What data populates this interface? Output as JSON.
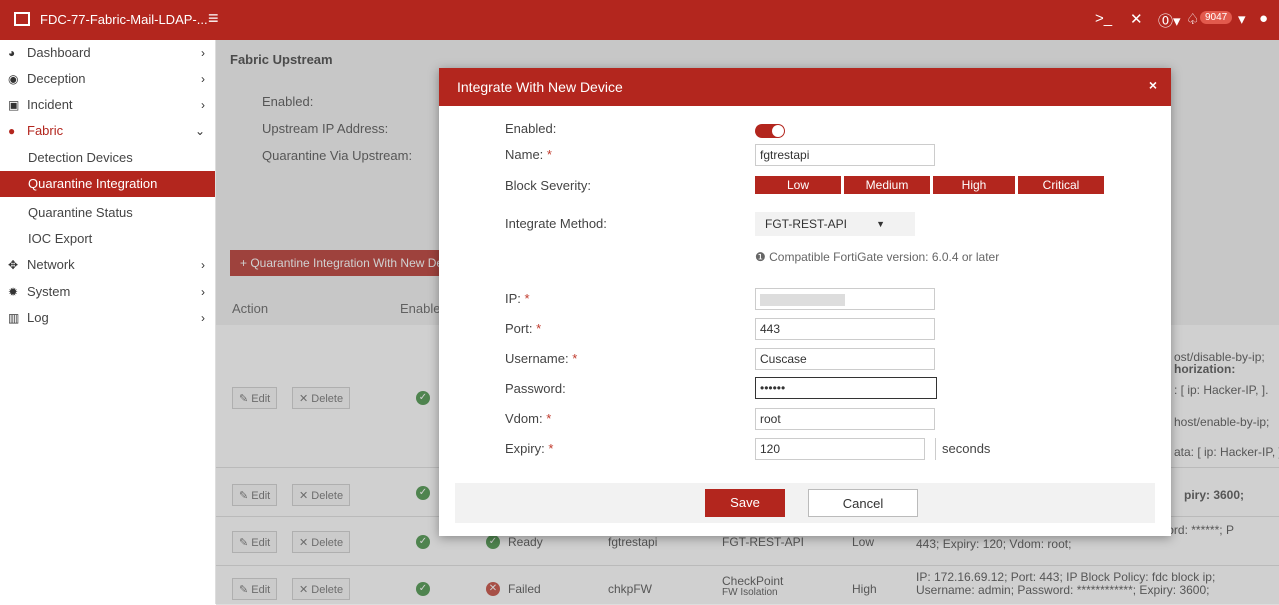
{
  "topbar": {
    "app_title": "FDC-77-Fabric-Mail-LDAP-...",
    "alert_count": "9047",
    "icons": [
      "terminal-icon",
      "tools-icon",
      "help-icon",
      "bell-icon",
      "user-icon"
    ]
  },
  "sidebar": {
    "items": [
      {
        "label": "Dashboard",
        "icon": "dashboard-icon"
      },
      {
        "label": "Deception",
        "icon": "deception-icon"
      },
      {
        "label": "Incident",
        "icon": "incident-icon"
      },
      {
        "label": "Fabric",
        "icon": "fabric-icon"
      },
      {
        "label": "Network",
        "icon": "network-icon"
      },
      {
        "label": "System",
        "icon": "gear-icon"
      },
      {
        "label": "Log",
        "icon": "log-icon"
      }
    ],
    "fabric_sub": [
      "Detection Devices",
      "Quarantine Integration",
      "Quarantine Status",
      "IOC Export"
    ]
  },
  "main": {
    "section_title": "Fabric Upstream",
    "upstream_labels": [
      "Enabled:",
      "Upstream IP Address:",
      "Quarantine Via Upstream:"
    ],
    "add_button": "+ Quarantine Integration With New Device",
    "columns": {
      "action": "Action",
      "enabled": "Enabled"
    },
    "edit_label": "Edit",
    "delete_label": "Delete",
    "row1_details": [
      "ost/disable-by-ip;",
      "horization:",
      ": [ ip: Hacker-IP, ].",
      "host/enable-by-ip;",
      "ata: [ ip: Hacker-IP, ]"
    ],
    "row2_details": "piry: 3600;",
    "row3": {
      "status": "Ready",
      "name": "fgtrestapi",
      "method": "FGT-REST-API",
      "severity": "Low",
      "detail_line1": "IP: 172.16.69.113;  Username: Cuscase;  Password: ******;  P",
      "detail_line2": "443;  Expiry: 120;  Vdom: root;"
    },
    "row4": {
      "status": "Failed",
      "name": "chkpFW",
      "method_line1": "CheckPoint",
      "method_line2": "FW Isolation",
      "severity": "High",
      "detail_line1": "IP: 172.16.69.12; Port: 443;  IP Block Policy: fdc block ip;",
      "detail_line2": "Username: admin;  Password: ************;  Expiry: 3600;"
    }
  },
  "modal": {
    "title": "Integrate With New Device",
    "labels": {
      "enabled": "Enabled:",
      "name": "Name:",
      "block_severity": "Block Severity:",
      "integrate_method": "Integrate Method:",
      "ip": "IP:",
      "port": "Port:",
      "username": "Username:",
      "password": "Password:",
      "vdom": "Vdom:",
      "expiry": "Expiry:"
    },
    "values": {
      "name": "fgtrestapi",
      "ip": "",
      "port": "443",
      "username": "Cuscase",
      "password": "••••••",
      "vdom": "root",
      "expiry": "120"
    },
    "expiry_unit": "seconds",
    "severity_options": [
      "Low",
      "Medium",
      "High",
      "Critical"
    ],
    "method_selected": "FGT-REST-API",
    "compat_note": "Compatible FortiGate version: 6.0.4 or later",
    "save_label": "Save",
    "cancel_label": "Cancel"
  }
}
